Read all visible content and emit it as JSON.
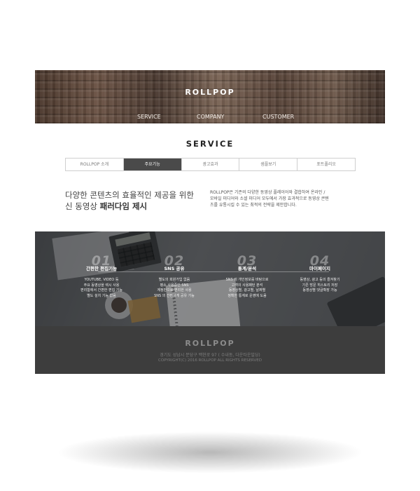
{
  "header": {
    "logo": "ROLLPOP",
    "nav": [
      "SERVICE",
      "COMPANY",
      "CUSTOMER"
    ]
  },
  "section": {
    "title": "SERVICE"
  },
  "tabs": {
    "items": [
      "ROLLPOP 소개",
      "주요기능",
      "광고효과",
      "샘플보기",
      "포트폴리오"
    ],
    "active_index": 1
  },
  "intro": {
    "headline_line1": "다양한 콘텐츠의 효율적인 제공을 위한",
    "headline_line2_prefix": "신 동영상 ",
    "headline_line2_bold": "패러다임 제시",
    "description": "ROLLPOP은 기존의 다양한 동영상 플레이어와 결합하여 온라인 / 모바일 미디어와 소셜 미디어 모두에서 가장 효과적으로 동영상 콘텐츠를 유통시킬 수 있는 최적의 전략을 제안합니다."
  },
  "features": [
    {
      "num": "01",
      "title": "간편한 편집기능",
      "text": [
        "YOUTUBE, VIDEO 등",
        "주요 동영상을 렉시 사용",
        "편리함에서 간편한 편집 기능",
        "별도 설치 기능 없음"
      ]
    },
    {
      "num": "02",
      "title": "SNS 공유",
      "text": [
        "별도의 회원가입 없음",
        "평소 사용중인 SNS",
        "계정만으로 편리한 사용",
        "SNS 의 간편하게 공유 가능"
      ]
    },
    {
      "num": "03",
      "title": "통계/분석",
      "text": [
        "SNS 의 개인정보를 바탕으로",
        "고객의 사용패턴 분석",
        "동영상별, 광고별, 날짜별",
        "정확한 통계로 운영에 도움"
      ]
    },
    {
      "num": "04",
      "title": "마이페이지",
      "text": [
        "동영상, 광고 등의 즐겨찾기",
        "기존 방문 히스토리 저장",
        "동영상별 댓글확장 가능"
      ]
    }
  ],
  "footer": {
    "logo": "ROLLPOP",
    "address": "경기도 성남시 분당구 백현로 97 ( 수내동, 다운타운빌딩)",
    "copyright": "COPYRIGHT(C) 2016 ROLLPOP ALL RIGHTS RESERVED"
  }
}
